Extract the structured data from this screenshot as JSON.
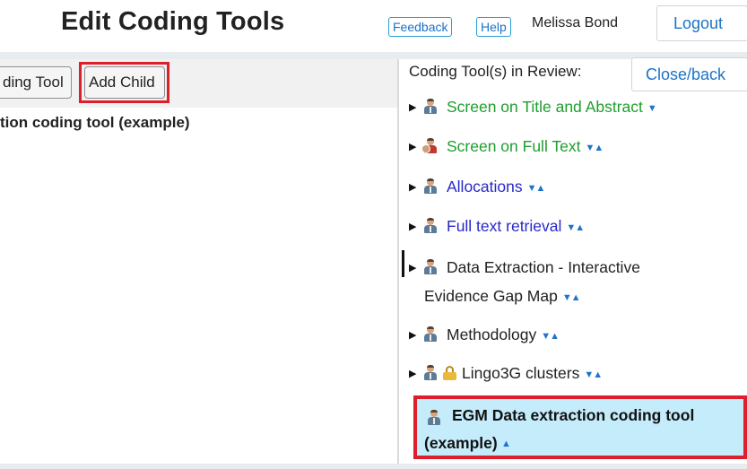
{
  "header": {
    "title": "Edit Coding Tools",
    "feedback_label": "Feedback",
    "help_label": "Help",
    "user_name": "Melissa Bond",
    "logout_label": "Logout"
  },
  "left_panel": {
    "toolbar": {
      "button_partial_label": "ding Tool",
      "add_child_label": "Add Child"
    },
    "heading": "tion coding tool (example)"
  },
  "right_panel": {
    "review_label": "Coding Tool(s) in Review:",
    "close_label": "Close/back",
    "items": [
      {
        "label": "Screen on Title and Abstract",
        "color": "#1e9e2e",
        "icon": "person-icon",
        "arrows": "▼"
      },
      {
        "label": "Screen on Full Text",
        "color": "#1e9e2e",
        "icon": "people-icon",
        "arrows": "▼▲"
      },
      {
        "label": "Allocations",
        "color": "#2828c8",
        "icon": "person-icon",
        "arrows": "▼▲"
      },
      {
        "label": "Full text retrieval",
        "color": "#2828c8",
        "icon": "person-icon",
        "arrows": "▼▲"
      },
      {
        "label_line1": "Data Extraction - Interactive",
        "label_line2": "Evidence Gap Map",
        "color": "#222222",
        "icon": "person-icon",
        "arrows": "▼▲"
      },
      {
        "label": "Methodology",
        "color": "#222222",
        "icon": "person-icon",
        "arrows": "▼▲"
      },
      {
        "label": "Lingo3G clusters",
        "color": "#222222",
        "icon": "person-lock-icon",
        "arrows": "▼▲"
      }
    ],
    "selected": {
      "label_line1": "EGM Data extraction coding tool",
      "label_line2": "(example)",
      "arrows": "▲",
      "background": "#c4ecfb",
      "highlight_color": "#dc1f2a"
    }
  }
}
